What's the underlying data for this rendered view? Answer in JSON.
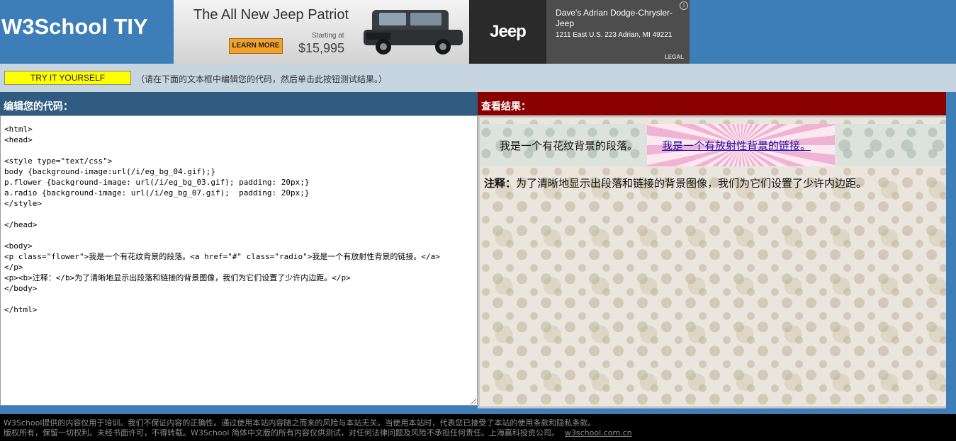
{
  "header": {
    "logo": "W3School TIY"
  },
  "ad": {
    "title": "The All New Jeep Patriot",
    "cta": "LEARN MORE",
    "starting_label": "Starting at",
    "price": "$15,995",
    "brand": "Jeep",
    "dealer_name": "Dave's Adrian Dodge-Chrysler-Jeep",
    "dealer_address": "1211 East U.S. 223 Adrian, MI 49221",
    "legal": "LEGAL",
    "info_glyph": "i"
  },
  "toolbar": {
    "button_label": "TRY IT YOURSELF",
    "hint": "（请在下面的文本框中编辑您的代码，然后单击此按钮测试结果。）"
  },
  "editor": {
    "heading": "编辑您的代码：",
    "code": "<html>\n<head>\n\n<style type=\"text/css\">\nbody {background-image:url(/i/eg_bg_04.gif);}\np.flower {background-image: url(/i/eg_bg_03.gif); padding: 20px;}\na.radio {background-image: url(/i/eg_bg_07.gif);  padding: 20px;}\n</style>\n\n</head>\n\n<body>\n<p class=\"flower\">我是一个有花纹背景的段落。<a href=\"#\" class=\"radio\">我是一个有放射性背景的链接。</a>\n</p>\n<p><b>注释：</b>为了清晰地显示出段落和链接的背景图像，我们为它们设置了少许内边距。</p>\n</body>\n\n</html>"
  },
  "result": {
    "heading": "查看结果：",
    "flower_text": "我是一个有花纹背景的段落。",
    "link_text": "我是一个有放射性背景的链接。",
    "note_label": "注释：",
    "note_text": "为了清晰地显示出段落和链接的背景图像，我们为它们设置了少许内边距。"
  },
  "footer": {
    "line1": "W3School提供的内容仅用于培训。我们不保证内容的正确性。通过使用本站内容随之而来的风险与本站无关。当使用本站时，代表您已接受了本站的使用条款和隐私条款。",
    "line2": "版权所有，保留一切权利。未经书面许可，不得转载。W3School 简体中文版的所有内容仅供测试，对任何法律问题及风险不承担任何责任。上海赢科投资公司。",
    "link": "w3school.com.cn"
  },
  "colors": {
    "header_bg": "#3d7eb8",
    "toolbar_bg": "#c7d5e0",
    "editor_head_bg": "#305c81",
    "result_head_bg": "#8b0000",
    "button_bg": "#ffff00",
    "link": "#1a0dab"
  }
}
